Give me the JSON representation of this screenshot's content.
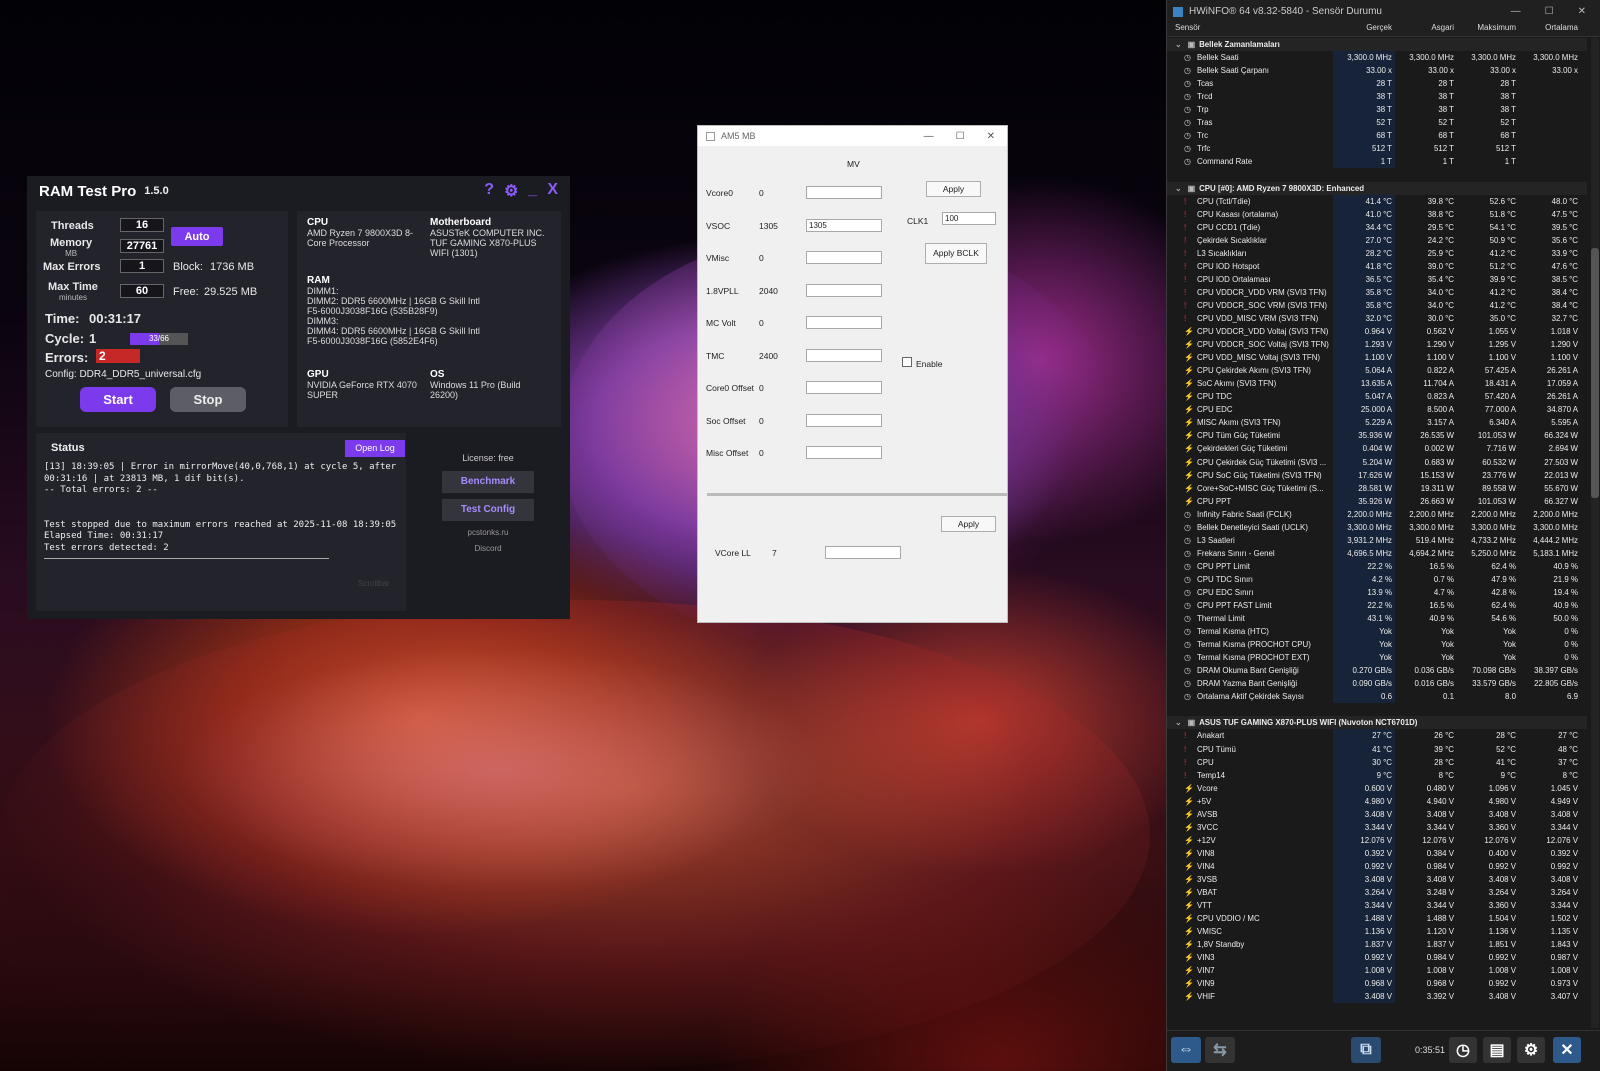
{
  "ramtest": {
    "title": "RAM Test Pro",
    "version": "1.5.0",
    "controls": {
      "help": "?",
      "settings": "⚙",
      "minimize": "_",
      "close": "X"
    },
    "threads_label": "Threads",
    "threads": "16",
    "memory_label": "Memory",
    "memory_unit": "MB",
    "memory": "27761",
    "auto_label": "Auto",
    "max_errors_label": "Max Errors",
    "max_errors": "1",
    "block_label": "Block:",
    "block": "1736 MB",
    "max_time_label": "Max Time",
    "max_time_unit": "minutes",
    "max_time": "60",
    "free_label": "Free:",
    "free": "29.525 MB",
    "time_label": "Time:",
    "time": "00:31:17",
    "cycle_label": "Cycle:",
    "cycle": "1",
    "cycle_progress": "33/66",
    "cycle_fraction": 0.5,
    "errors_label": "Errors:",
    "errors": "2",
    "config": "Config: DDR4_DDR5_universal.cfg",
    "start_label": "Start",
    "stop_label": "Stop",
    "cpu_h": "CPU",
    "cpu": "AMD Ryzen 7 9800X3D 8-Core Processor",
    "mb_h": "Motherboard",
    "mb": "ASUSTeK COMPUTER INC. TUF GAMING X870-PLUS WIFI (1301)",
    "ram_h": "RAM",
    "ram_lines": [
      "DIMM1:",
      "DIMM2: DDR5 6600MHz | 16GB G Skill Intl",
      "F5-6000J3038F16G (535B28F9)",
      "DIMM3:",
      "DIMM4: DDR5 6600MHz | 16GB G Skill Intl",
      "F5-6000J3038F16G (5852E4F6)"
    ],
    "gpu_h": "GPU",
    "gpu": "NVIDIA GeForce RTX 4070 SUPER",
    "os_h": "OS",
    "os": "Windows 11 Pro (Build 26200)",
    "status_h": "Status",
    "open_log": "Open Log",
    "log": "[13] 18:39:05 | Error in mirrorMove(40,0,768,1) at cycle 5, after\n00:31:16 | at 23813 MB, 1 dif bit(s).\n-- Total errors: 2 --\n\n\nTest stopped due to maximum errors reached at 2025-11-08 18:39:05\nElapsed Time: 00:31:17\nTest errors detected: 2",
    "scrollbar": "Scrollbar",
    "license": "License: free",
    "benchmark": "Benchmark",
    "test_config": "Test Config",
    "site": "pcstonks.ru",
    "discord": "Discord"
  },
  "am5": {
    "title": "AM5 MB",
    "mv": "MV",
    "rows": [
      {
        "label": "Vcore0",
        "value": "0",
        "input": ""
      },
      {
        "label": "VSOC",
        "value": "1305",
        "input": "1305"
      },
      {
        "label": "VMisc",
        "value": "0",
        "input": ""
      },
      {
        "label": "1.8VPLL",
        "value": "2040",
        "input": ""
      },
      {
        "label": "MC Volt",
        "value": "0",
        "input": ""
      },
      {
        "label": "TMC",
        "value": "2400",
        "input": ""
      },
      {
        "label": "Core0 Offset",
        "value": "0",
        "input": ""
      },
      {
        "label": "Soc Offset",
        "value": "0",
        "input": ""
      },
      {
        "label": "Misc Offset",
        "value": "0",
        "input": ""
      }
    ],
    "apply": "Apply",
    "clk_label": "CLK1",
    "clk": "100",
    "apply_bclk": "Apply BCLK",
    "enable": "Enable",
    "apply2": "Apply",
    "vcorell_label": "VCore LL",
    "vcorell": "7"
  },
  "hwinfo": {
    "title": "HWiNFO® 64 v8.32-5840 - Sensör Durumu",
    "headers": [
      "Sensör",
      "Gerçek",
      "Asgari",
      "Maksimum",
      "Ortalama"
    ],
    "time": "0:35:51",
    "rows": [
      {
        "g": "Bellek Zamanlamaları"
      },
      {
        "n": "Bellek Saati",
        "i": "clock",
        "v": [
          "3,300.0 MHz",
          "3,300.0 MHz",
          "3,300.0 MHz",
          "3,300.0 MHz"
        ]
      },
      {
        "n": "Bellek Saati Çarpanı",
        "i": "clock",
        "v": [
          "33.00 x",
          "33.00 x",
          "33.00 x",
          "33.00 x"
        ]
      },
      {
        "n": "Tcas",
        "i": "clock",
        "v": [
          "28 T",
          "28 T",
          "28 T",
          ""
        ]
      },
      {
        "n": "Trcd",
        "i": "clock",
        "v": [
          "38 T",
          "38 T",
          "38 T",
          ""
        ]
      },
      {
        "n": "Trp",
        "i": "clock",
        "v": [
          "38 T",
          "38 T",
          "38 T",
          ""
        ]
      },
      {
        "n": "Tras",
        "i": "clock",
        "v": [
          "52 T",
          "52 T",
          "52 T",
          ""
        ]
      },
      {
        "n": "Trc",
        "i": "clock",
        "v": [
          "68 T",
          "68 T",
          "68 T",
          ""
        ]
      },
      {
        "n": "Trfc",
        "i": "clock",
        "v": [
          "512 T",
          "512 T",
          "512 T",
          ""
        ]
      },
      {
        "n": "Command Rate",
        "i": "clock",
        "v": [
          "1 T",
          "1 T",
          "1 T",
          ""
        ]
      },
      {
        "blank": true
      },
      {
        "g": "CPU [#0]: AMD Ryzen 7 9800X3D: Enhanced"
      },
      {
        "n": "CPU (Tctl/Tdie)",
        "i": "temp",
        "v": [
          "41.4 °C",
          "39.8 °C",
          "52.6 °C",
          "48.0 °C"
        ]
      },
      {
        "n": "CPU Kasası (ortalama)",
        "i": "temp",
        "v": [
          "41.0 °C",
          "38.8 °C",
          "51.8 °C",
          "47.5 °C"
        ]
      },
      {
        "n": "CPU CCD1 (Tdie)",
        "i": "temp",
        "v": [
          "34.4 °C",
          "29.5 °C",
          "54.1 °C",
          "39.5 °C"
        ]
      },
      {
        "n": "Çekirdek Sıcaklıklar",
        "i": "temp",
        "v": [
          "27.0 °C",
          "24.2 °C",
          "50.9 °C",
          "35.6 °C"
        ]
      },
      {
        "n": "L3 Sıcaklıkları",
        "i": "temp",
        "v": [
          "28.2 °C",
          "25.9 °C",
          "41.2 °C",
          "33.9 °C"
        ]
      },
      {
        "n": "CPU IOD Hotspot",
        "i": "temp",
        "v": [
          "41.8 °C",
          "39.0 °C",
          "51.2 °C",
          "47.6 °C"
        ]
      },
      {
        "n": "CPU IOD Ortalaması",
        "i": "temp",
        "v": [
          "36.5 °C",
          "35.4 °C",
          "39.9 °C",
          "38.5 °C"
        ]
      },
      {
        "n": "CPU VDDCR_VDD VRM (SVI3 TFN)",
        "i": "temp",
        "v": [
          "35.8 °C",
          "34.0 °C",
          "41.2 °C",
          "38.4 °C"
        ]
      },
      {
        "n": "CPU VDDCR_SOC VRM (SVI3 TFN)",
        "i": "temp",
        "v": [
          "35.8 °C",
          "34.0 °C",
          "41.2 °C",
          "38.4 °C"
        ]
      },
      {
        "n": "CPU VDD_MISC VRM (SVI3 TFN)",
        "i": "temp",
        "v": [
          "32.0 °C",
          "30.0 °C",
          "35.0 °C",
          "32.7 °C"
        ]
      },
      {
        "n": "CPU VDDCR_VDD Voltaj (SVI3 TFN)",
        "i": "volt",
        "v": [
          "0.964 V",
          "0.562 V",
          "1.055 V",
          "1.018 V"
        ]
      },
      {
        "n": "CPU VDDCR_SOC Voltaj (SVI3 TFN)",
        "i": "volt",
        "v": [
          "1.293 V",
          "1.290 V",
          "1.295 V",
          "1.290 V"
        ]
      },
      {
        "n": "CPU VDD_MISC Voltaj (SVI3 TFN)",
        "i": "volt",
        "v": [
          "1.100 V",
          "1.100 V",
          "1.100 V",
          "1.100 V"
        ]
      },
      {
        "n": "CPU Çekirdek Akımı (SVI3 TFN)",
        "i": "volt",
        "v": [
          "5.064 A",
          "0.822 A",
          "57.425 A",
          "26.261 A"
        ]
      },
      {
        "n": "SoC Akımı (SVI3 TFN)",
        "i": "volt",
        "v": [
          "13.635 A",
          "11.704 A",
          "18.431 A",
          "17.059 A"
        ]
      },
      {
        "n": "CPU TDC",
        "i": "volt",
        "v": [
          "5.047 A",
          "0.823 A",
          "57.420 A",
          "26.261 A"
        ]
      },
      {
        "n": "CPU EDC",
        "i": "volt",
        "v": [
          "25.000 A",
          "8.500 A",
          "77.000 A",
          "34.870 A"
        ]
      },
      {
        "n": "MISC Akımı (SVI3 TFN)",
        "i": "volt",
        "v": [
          "5.229 A",
          "3.157 A",
          "6.340 A",
          "5.595 A"
        ]
      },
      {
        "n": "CPU Tüm Güç Tüketimi",
        "i": "volt",
        "v": [
          "35.936 W",
          "26.535 W",
          "101.053 W",
          "66.324 W"
        ]
      },
      {
        "n": "Çekirdekleri Güç Tüketimi",
        "i": "volt",
        "v": [
          "0.404 W",
          "0.002 W",
          "7.716 W",
          "2.694 W"
        ]
      },
      {
        "n": "CPU Çekirdek Güç Tüketimi (SVI3 ...",
        "i": "volt",
        "v": [
          "5.204 W",
          "0.683 W",
          "60.532 W",
          "27.503 W"
        ]
      },
      {
        "n": "CPU SoC Güç Tüketimi (SVI3 TFN)",
        "i": "volt",
        "v": [
          "17.626 W",
          "15.153 W",
          "23.776 W",
          "22.013 W"
        ]
      },
      {
        "n": "Core+SoC+MISC Güç Tüketimi (S...",
        "i": "volt",
        "v": [
          "28.581 W",
          "19.311 W",
          "89.558 W",
          "55.670 W"
        ]
      },
      {
        "n": "CPU PPT",
        "i": "volt",
        "v": [
          "35.926 W",
          "26.663 W",
          "101.053 W",
          "66.327 W"
        ]
      },
      {
        "n": "Infinity Fabric Saati (FCLK)",
        "i": "clock",
        "v": [
          "2,200.0 MHz",
          "2,200.0 MHz",
          "2,200.0 MHz",
          "2,200.0 MHz"
        ]
      },
      {
        "n": "Bellek Denetleyici Saati (UCLK)",
        "i": "clock",
        "v": [
          "3,300.0 MHz",
          "3,300.0 MHz",
          "3,300.0 MHz",
          "3,300.0 MHz"
        ]
      },
      {
        "n": "L3 Saatleri",
        "i": "clock",
        "v": [
          "3,931.2 MHz",
          "519.4 MHz",
          "4,733.2 MHz",
          "4,444.2 MHz"
        ]
      },
      {
        "n": "Frekans Sınırı - Genel",
        "i": "clock",
        "v": [
          "4,696.5 MHz",
          "4,694.2 MHz",
          "5,250.0 MHz",
          "5,183.1 MHz"
        ]
      },
      {
        "n": "CPU PPT Limit",
        "i": "clock",
        "v": [
          "22.2 %",
          "16.5 %",
          "62.4 %",
          "40.9 %"
        ]
      },
      {
        "n": "CPU TDC Sınırı",
        "i": "clock",
        "v": [
          "4.2 %",
          "0.7 %",
          "47.9 %",
          "21.9 %"
        ]
      },
      {
        "n": "CPU EDC Sınırı",
        "i": "clock",
        "v": [
          "13.9 %",
          "4.7 %",
          "42.8 %",
          "19.4 %"
        ]
      },
      {
        "n": "CPU PPT FAST Limit",
        "i": "clock",
        "v": [
          "22.2 %",
          "16.5 %",
          "62.4 %",
          "40.9 %"
        ]
      },
      {
        "n": "Thermal Limit",
        "i": "clock",
        "v": [
          "43.1 %",
          "40.9 %",
          "54.6 %",
          "50.0 %"
        ]
      },
      {
        "n": "Termal Kısma (HTC)",
        "i": "clock",
        "v": [
          "Yok",
          "Yok",
          "Yok",
          "0 %"
        ]
      },
      {
        "n": "Termal Kısma (PROCHOT CPU)",
        "i": "clock",
        "v": [
          "Yok",
          "Yok",
          "Yok",
          "0 %"
        ]
      },
      {
        "n": "Termal Kısma (PROCHOT EXT)",
        "i": "clock",
        "v": [
          "Yok",
          "Yok",
          "Yok",
          "0 %"
        ]
      },
      {
        "n": "DRAM Okuma Bant Genişliği",
        "i": "clock",
        "v": [
          "0.270 GB/s",
          "0.036 GB/s",
          "70.098 GB/s",
          "38.397 GB/s"
        ]
      },
      {
        "n": "DRAM Yazma Bant Genişliği",
        "i": "clock",
        "v": [
          "0.090 GB/s",
          "0.016 GB/s",
          "33.579 GB/s",
          "22.805 GB/s"
        ]
      },
      {
        "n": "Ortalama Aktif Çekirdek Sayısı",
        "i": "clock",
        "v": [
          "0.6",
          "0.1",
          "8.0",
          "6.9"
        ]
      },
      {
        "blank": true
      },
      {
        "g": "ASUS TUF GAMING X870-PLUS WIFI (Nuvoton NCT6701D)"
      },
      {
        "n": "Anakart",
        "i": "temp",
        "v": [
          "27 °C",
          "26 °C",
          "28 °C",
          "27 °C"
        ]
      },
      {
        "n": "CPU Tümü",
        "i": "temp",
        "v": [
          "41 °C",
          "39 °C",
          "52 °C",
          "48 °C"
        ]
      },
      {
        "n": "CPU",
        "i": "temp",
        "v": [
          "30 °C",
          "28 °C",
          "41 °C",
          "37 °C"
        ]
      },
      {
        "n": "Temp14",
        "i": "temp",
        "v": [
          "9 °C",
          "8 °C",
          "9 °C",
          "8 °C"
        ]
      },
      {
        "n": "Vcore",
        "i": "volt",
        "v": [
          "0.600 V",
          "0.480 V",
          "1.096 V",
          "1.045 V"
        ]
      },
      {
        "n": "+5V",
        "i": "volt",
        "v": [
          "4.980 V",
          "4.940 V",
          "4.980 V",
          "4.949 V"
        ]
      },
      {
        "n": "AVSB",
        "i": "volt",
        "v": [
          "3.408 V",
          "3.408 V",
          "3.408 V",
          "3.408 V"
        ]
      },
      {
        "n": "3VCC",
        "i": "volt",
        "v": [
          "3.344 V",
          "3.344 V",
          "3.360 V",
          "3.344 V"
        ]
      },
      {
        "n": "+12V",
        "i": "volt",
        "v": [
          "12.076 V",
          "12.076 V",
          "12.076 V",
          "12.076 V"
        ]
      },
      {
        "n": "VIN8",
        "i": "volt",
        "v": [
          "0.392 V",
          "0.384 V",
          "0.400 V",
          "0.392 V"
        ]
      },
      {
        "n": "VIN4",
        "i": "volt",
        "v": [
          "0.992 V",
          "0.984 V",
          "0.992 V",
          "0.992 V"
        ]
      },
      {
        "n": "3VSB",
        "i": "volt",
        "v": [
          "3.408 V",
          "3.408 V",
          "3.408 V",
          "3.408 V"
        ]
      },
      {
        "n": "VBAT",
        "i": "volt",
        "v": [
          "3.264 V",
          "3.248 V",
          "3.264 V",
          "3.264 V"
        ]
      },
      {
        "n": "VTT",
        "i": "volt",
        "v": [
          "3.344 V",
          "3.344 V",
          "3.360 V",
          "3.344 V"
        ]
      },
      {
        "n": "CPU VDDIO / MC",
        "i": "volt",
        "v": [
          "1.488 V",
          "1.488 V",
          "1.504 V",
          "1.502 V"
        ]
      },
      {
        "n": "VMISC",
        "i": "volt",
        "v": [
          "1.136 V",
          "1.120 V",
          "1.136 V",
          "1.135 V"
        ]
      },
      {
        "n": "1,8V Standby",
        "i": "volt",
        "v": [
          "1.837 V",
          "1.837 V",
          "1.851 V",
          "1.843 V"
        ]
      },
      {
        "n": "VIN3",
        "i": "volt",
        "v": [
          "0.992 V",
          "0.984 V",
          "0.992 V",
          "0.987 V"
        ]
      },
      {
        "n": "VIN7",
        "i": "volt",
        "v": [
          "1.008 V",
          "1.008 V",
          "1.008 V",
          "1.008 V"
        ]
      },
      {
        "n": "VIN9",
        "i": "volt",
        "v": [
          "0.968 V",
          "0.968 V",
          "0.992 V",
          "0.973 V"
        ]
      },
      {
        "n": "VHIF",
        "i": "volt",
        "v": [
          "3.408 V",
          "3.392 V",
          "3.408 V",
          "3.407 V"
        ]
      }
    ]
  },
  "colors": {
    "accent": "#7c3aed",
    "error": "#c62828",
    "hw_blue": "#172338",
    "temp_icon": "#e03030",
    "volt_icon": "#f0b020"
  }
}
